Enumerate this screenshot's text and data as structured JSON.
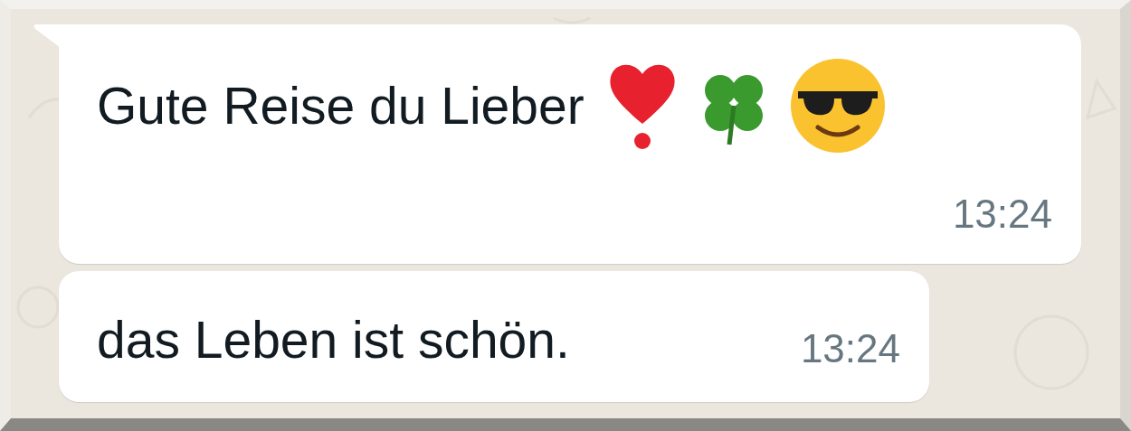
{
  "messages": [
    {
      "kind": "emoji",
      "text": "Gute Reise du Lieber",
      "time": "13:24",
      "tail": true
    },
    {
      "kind": "plain",
      "text": "das Leben ist schön.",
      "time": "13:24",
      "tail": false
    }
  ]
}
